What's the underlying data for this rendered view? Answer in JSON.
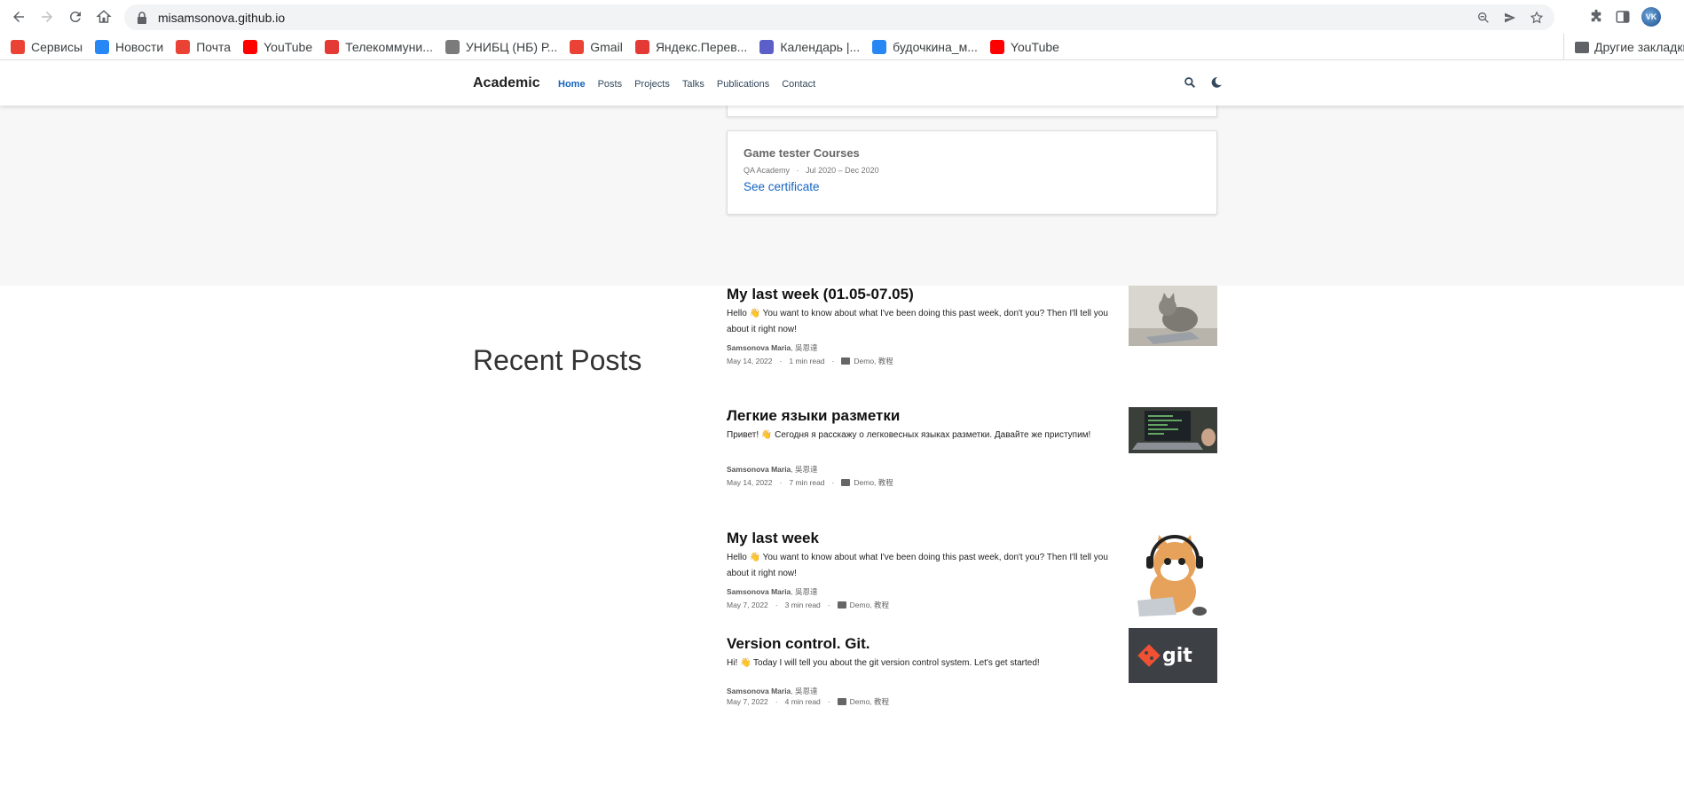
{
  "browser": {
    "url": "misamsonova.github.io",
    "bookmarks": [
      {
        "label": "Сервисы",
        "color": "#ea4335"
      },
      {
        "label": "Новости",
        "color": "#2787f5"
      },
      {
        "label": "Почта",
        "color": "#ea4335"
      },
      {
        "label": "YouTube",
        "color": "#ff0000"
      },
      {
        "label": "Телекоммуни...",
        "color": "#e53935"
      },
      {
        "label": "УНИБЦ (НБ) Р...",
        "color": "#7b7b7b"
      },
      {
        "label": "Gmail",
        "color": "#ea4335"
      },
      {
        "label": "Яндекс.Перев...",
        "color": "#e53935"
      },
      {
        "label": "Календарь |...",
        "color": "#5b5fc7"
      },
      {
        "label": "будочкина_м...",
        "color": "#2787f5"
      },
      {
        "label": "YouTube",
        "color": "#ff0000"
      }
    ],
    "other_bookmarks": "Другие закладки",
    "avatar_initials": "VK"
  },
  "site": {
    "brand": "Academic",
    "menu": [
      "Home",
      "Posts",
      "Projects",
      "Talks",
      "Publications",
      "Contact"
    ],
    "active_menu": "Home",
    "accent_color": "#1565c0"
  },
  "course": {
    "title": "Game tester Courses",
    "org": "QA Academy",
    "dates": "Jul 2020 – Dec 2020",
    "link": "See certificate"
  },
  "recent": {
    "heading": "Recent Posts",
    "posts": [
      {
        "title": "My last week (01.05-07.05)",
        "summary": "Hello 👋 You want to know about what I've been doing this past week, don't you? Then I'll tell you about it right now!",
        "author": "Samsonova Maria",
        "coauthor": "吳恩達",
        "date": "May 14, 2022",
        "read": "1 min read",
        "tags": "Demo, 教程",
        "image": "cat-laptop"
      },
      {
        "title": "Легкие языки разметки",
        "summary": "Привет! 👋 Сегодня я расскажу о легковесных языках разметки. Давайте же приступим!",
        "author": "Samsonova Maria",
        "coauthor": "吳恩達",
        "date": "May 14, 2022",
        "read": "7 min read",
        "tags": "Demo, 教程",
        "image": "laptop-code"
      },
      {
        "title": "My last week",
        "summary": "Hello 👋 You want to know about what I've been doing this past week, don't you? Then I'll tell you about it right now!",
        "author": "Samsonova Maria",
        "coauthor": "吳恩達",
        "date": "May 7, 2022",
        "read": "3 min read",
        "tags": "Demo, 教程",
        "image": "cartoon-cat"
      },
      {
        "title": "Version control. Git.",
        "summary": "Hi! 👋 Today I will tell you about the git version control system. Let's get started!",
        "author": "Samsonova Maria",
        "coauthor": "吳恩達",
        "date": "May 7, 2022",
        "read": "4 min read",
        "tags": "Demo, 教程",
        "image": "git-logo"
      }
    ]
  }
}
